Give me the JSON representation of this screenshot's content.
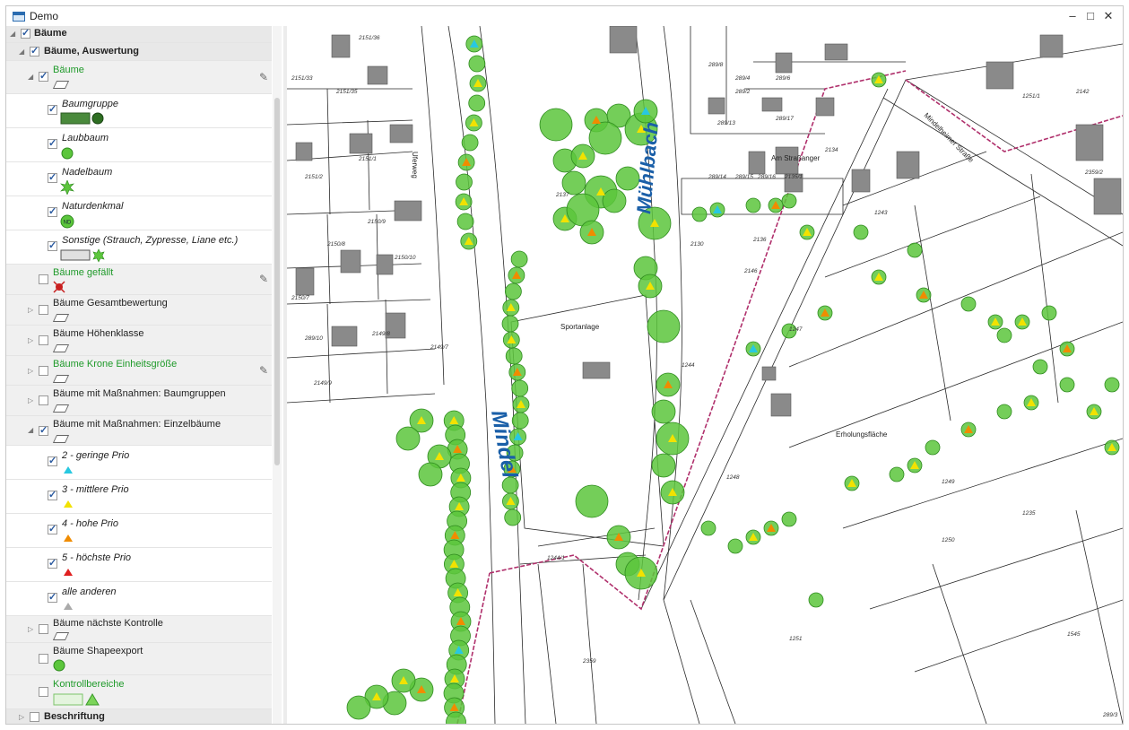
{
  "window": {
    "title": "Demo",
    "controls": {
      "minimize": "–",
      "maximize": "□",
      "close": "✕"
    }
  },
  "tree": {
    "root": {
      "label": "Bäume",
      "checked": true
    },
    "group": {
      "label": "Bäume, Auswertung",
      "checked": true
    },
    "layer_baeume": {
      "label": "Bäume",
      "checked": true
    },
    "legend": [
      {
        "label": "Baumgruppe",
        "checked": true
      },
      {
        "label": "Laubbaum",
        "checked": true
      },
      {
        "label": "Nadelbaum",
        "checked": true
      },
      {
        "label": "Naturdenkmal",
        "checked": true,
        "badge": "ND"
      },
      {
        "label": "Sonstige (Strauch, Zypresse, Liane etc.)",
        "checked": true
      }
    ],
    "layers": [
      {
        "label": "Bäume gefällt",
        "checked": false,
        "green": true
      },
      {
        "label": "Bäume Gesamtbewertung",
        "checked": false
      },
      {
        "label": "Bäume Höhenklasse",
        "checked": false
      },
      {
        "label": "Bäume Krone Einheitsgröße",
        "checked": false,
        "green": true
      },
      {
        "label": "Bäume mit Maßnahmen: Baumgruppen",
        "checked": false
      },
      {
        "label": "Bäume mit Maßnahmen: Einzelbäume",
        "checked": true
      }
    ],
    "priorities": [
      {
        "label": "2 - geringe Prio",
        "checked": true,
        "color": "#28c8e0"
      },
      {
        "label": "3 - mittlere Prio",
        "checked": true,
        "color": "#f2e200"
      },
      {
        "label": "4 - hohe Prio",
        "checked": true,
        "color": "#f08c00"
      },
      {
        "label": "5 - höchste Prio",
        "checked": true,
        "color": "#e02020"
      },
      {
        "label": "alle anderen",
        "checked": true,
        "color": "#aaaaaa"
      }
    ],
    "bottom_layers": [
      {
        "label": "Bäume nächste Kontrolle",
        "checked": false
      },
      {
        "label": "Bäume Shapeexport",
        "checked": false
      },
      {
        "label": "Kontrollbereiche",
        "checked": false,
        "green": true
      }
    ],
    "beschriftung": {
      "label": "Beschriftung",
      "checked": false
    }
  },
  "map": {
    "water_labels": [
      "Mindel",
      "Mühlbach"
    ],
    "street_labels": [
      "Am Straßanger",
      "Mindelheimer Straße",
      "Uferweg"
    ],
    "area_labels": [
      "Sportanlage",
      "Erholungsfläche"
    ],
    "parcel_labels": [
      "2151/36",
      "2151/33",
      "2151/35",
      "2151/1",
      "2151/2",
      "2150/9",
      "2150/8",
      "2150/10",
      "2150/7",
      "2149/8",
      "2149/9",
      "2149/7",
      "289/10",
      "289/8",
      "289/4",
      "289/2",
      "289/6",
      "289/17",
      "289/13",
      "289/14",
      "289/15",
      "289/16",
      "2135/1",
      "2134",
      "2130",
      "2137",
      "2136",
      "2146",
      "1244",
      "1244/1",
      "1243",
      "1247",
      "1248",
      "1249",
      "1250",
      "1251",
      "1235",
      "1545",
      "2359",
      "2359/2",
      "1251/1",
      "2142",
      "289/3"
    ],
    "colors": {
      "tree_fill": "#5cc63c",
      "tree_stroke": "#2e8a1e",
      "water_label": "#1a5fa8",
      "boundary": "#b0306c",
      "building": "#8a8a8a",
      "prio2": "#28c8e0",
      "prio3": "#f2e200",
      "prio4": "#f08c00",
      "prio5": "#e02020"
    }
  }
}
